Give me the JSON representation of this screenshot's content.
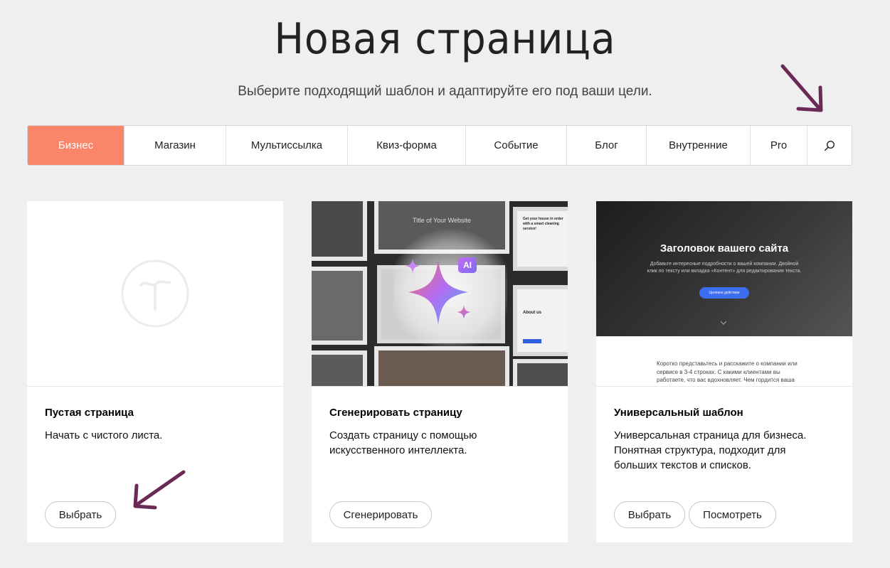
{
  "page": {
    "title": "Новая страница",
    "subtitle": "Выберите подходящий шаблон и адаптируйте его под ваши цели."
  },
  "tabs": [
    {
      "label": "Бизнес",
      "active": true
    },
    {
      "label": "Магазин"
    },
    {
      "label": "Мультиссылка"
    },
    {
      "label": "Квиз-форма"
    },
    {
      "label": "Событие"
    },
    {
      "label": "Блог"
    },
    {
      "label": "Внутренние"
    },
    {
      "label": "Pro"
    }
  ],
  "colors": {
    "accent": "#fa8669",
    "annotation_arrow": "#6b2a55"
  },
  "cards": [
    {
      "title": "Пустая страница",
      "description": "Начать с чистого листа.",
      "buttons": [
        "Выбрать"
      ]
    },
    {
      "title": "Сгенерировать страницу",
      "description": "Создать страницу с помощью искусственного интеллекта.",
      "buttons": [
        "Сгенерировать"
      ],
      "preview": {
        "site_title": "Title of Your Website",
        "ai_badge": "AI",
        "about": "About us",
        "form_heading": "Get your house in order with a smart cleaning service!"
      }
    },
    {
      "title": "Универсальный шаблон",
      "description": "Универсальная страница для бизнеса. Понятная структура, подходит для больших текстов и списков.",
      "buttons": [
        "Выбрать",
        "Посмотреть"
      ],
      "preview": {
        "hero_title": "Заголовок вашего сайта",
        "hero_subtitle": "Добавьте интересные подробности о вашей компании. Двойной клик по тексту или вкладка «Контент» для редактирования текста.",
        "hero_button": "Целевое действие",
        "body_text": "Коротко представьтесь и расскажите о компании или сервисе в 3-4 строках. С какими клиентами вы работаете, что вас вдохновляет. Чем гордится ваша команда, какие у нее ценности и мотивация."
      }
    }
  ]
}
